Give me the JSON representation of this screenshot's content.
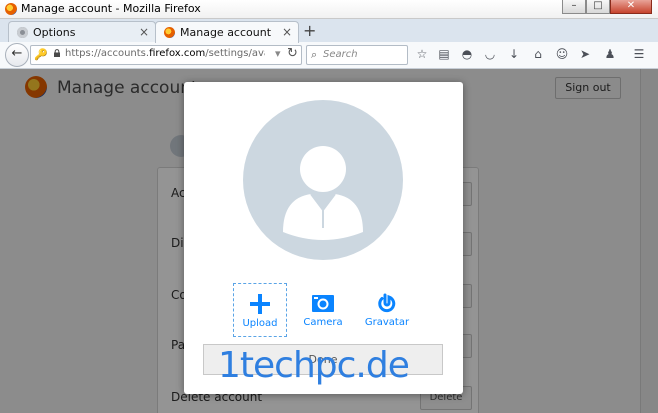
{
  "window": {
    "title": "Manage account - Mozilla Firefox"
  },
  "tabs": [
    {
      "label": "Options"
    },
    {
      "label": "Manage account"
    }
  ],
  "navbar": {
    "url_prefix": "https://accounts.",
    "url_domain": "firefox.com",
    "url_path": "/settings/avatar/change?se",
    "search_placeholder": "Search"
  },
  "page": {
    "title": "Manage account",
    "sign_out": "Sign out",
    "rows": [
      {
        "label": "Ac"
      },
      {
        "label": "Di"
      },
      {
        "label": "Co"
      },
      {
        "label": "Pa"
      },
      {
        "label": "Delete account",
        "button": "Delete"
      }
    ]
  },
  "modal": {
    "options": [
      {
        "label": "Upload"
      },
      {
        "label": "Camera"
      },
      {
        "label": "Gravatar"
      }
    ],
    "done": "Done"
  },
  "watermark": "1techpc.de",
  "colors": {
    "accent": "#0a84ff",
    "avatar_bg": "#ccd7e0"
  }
}
